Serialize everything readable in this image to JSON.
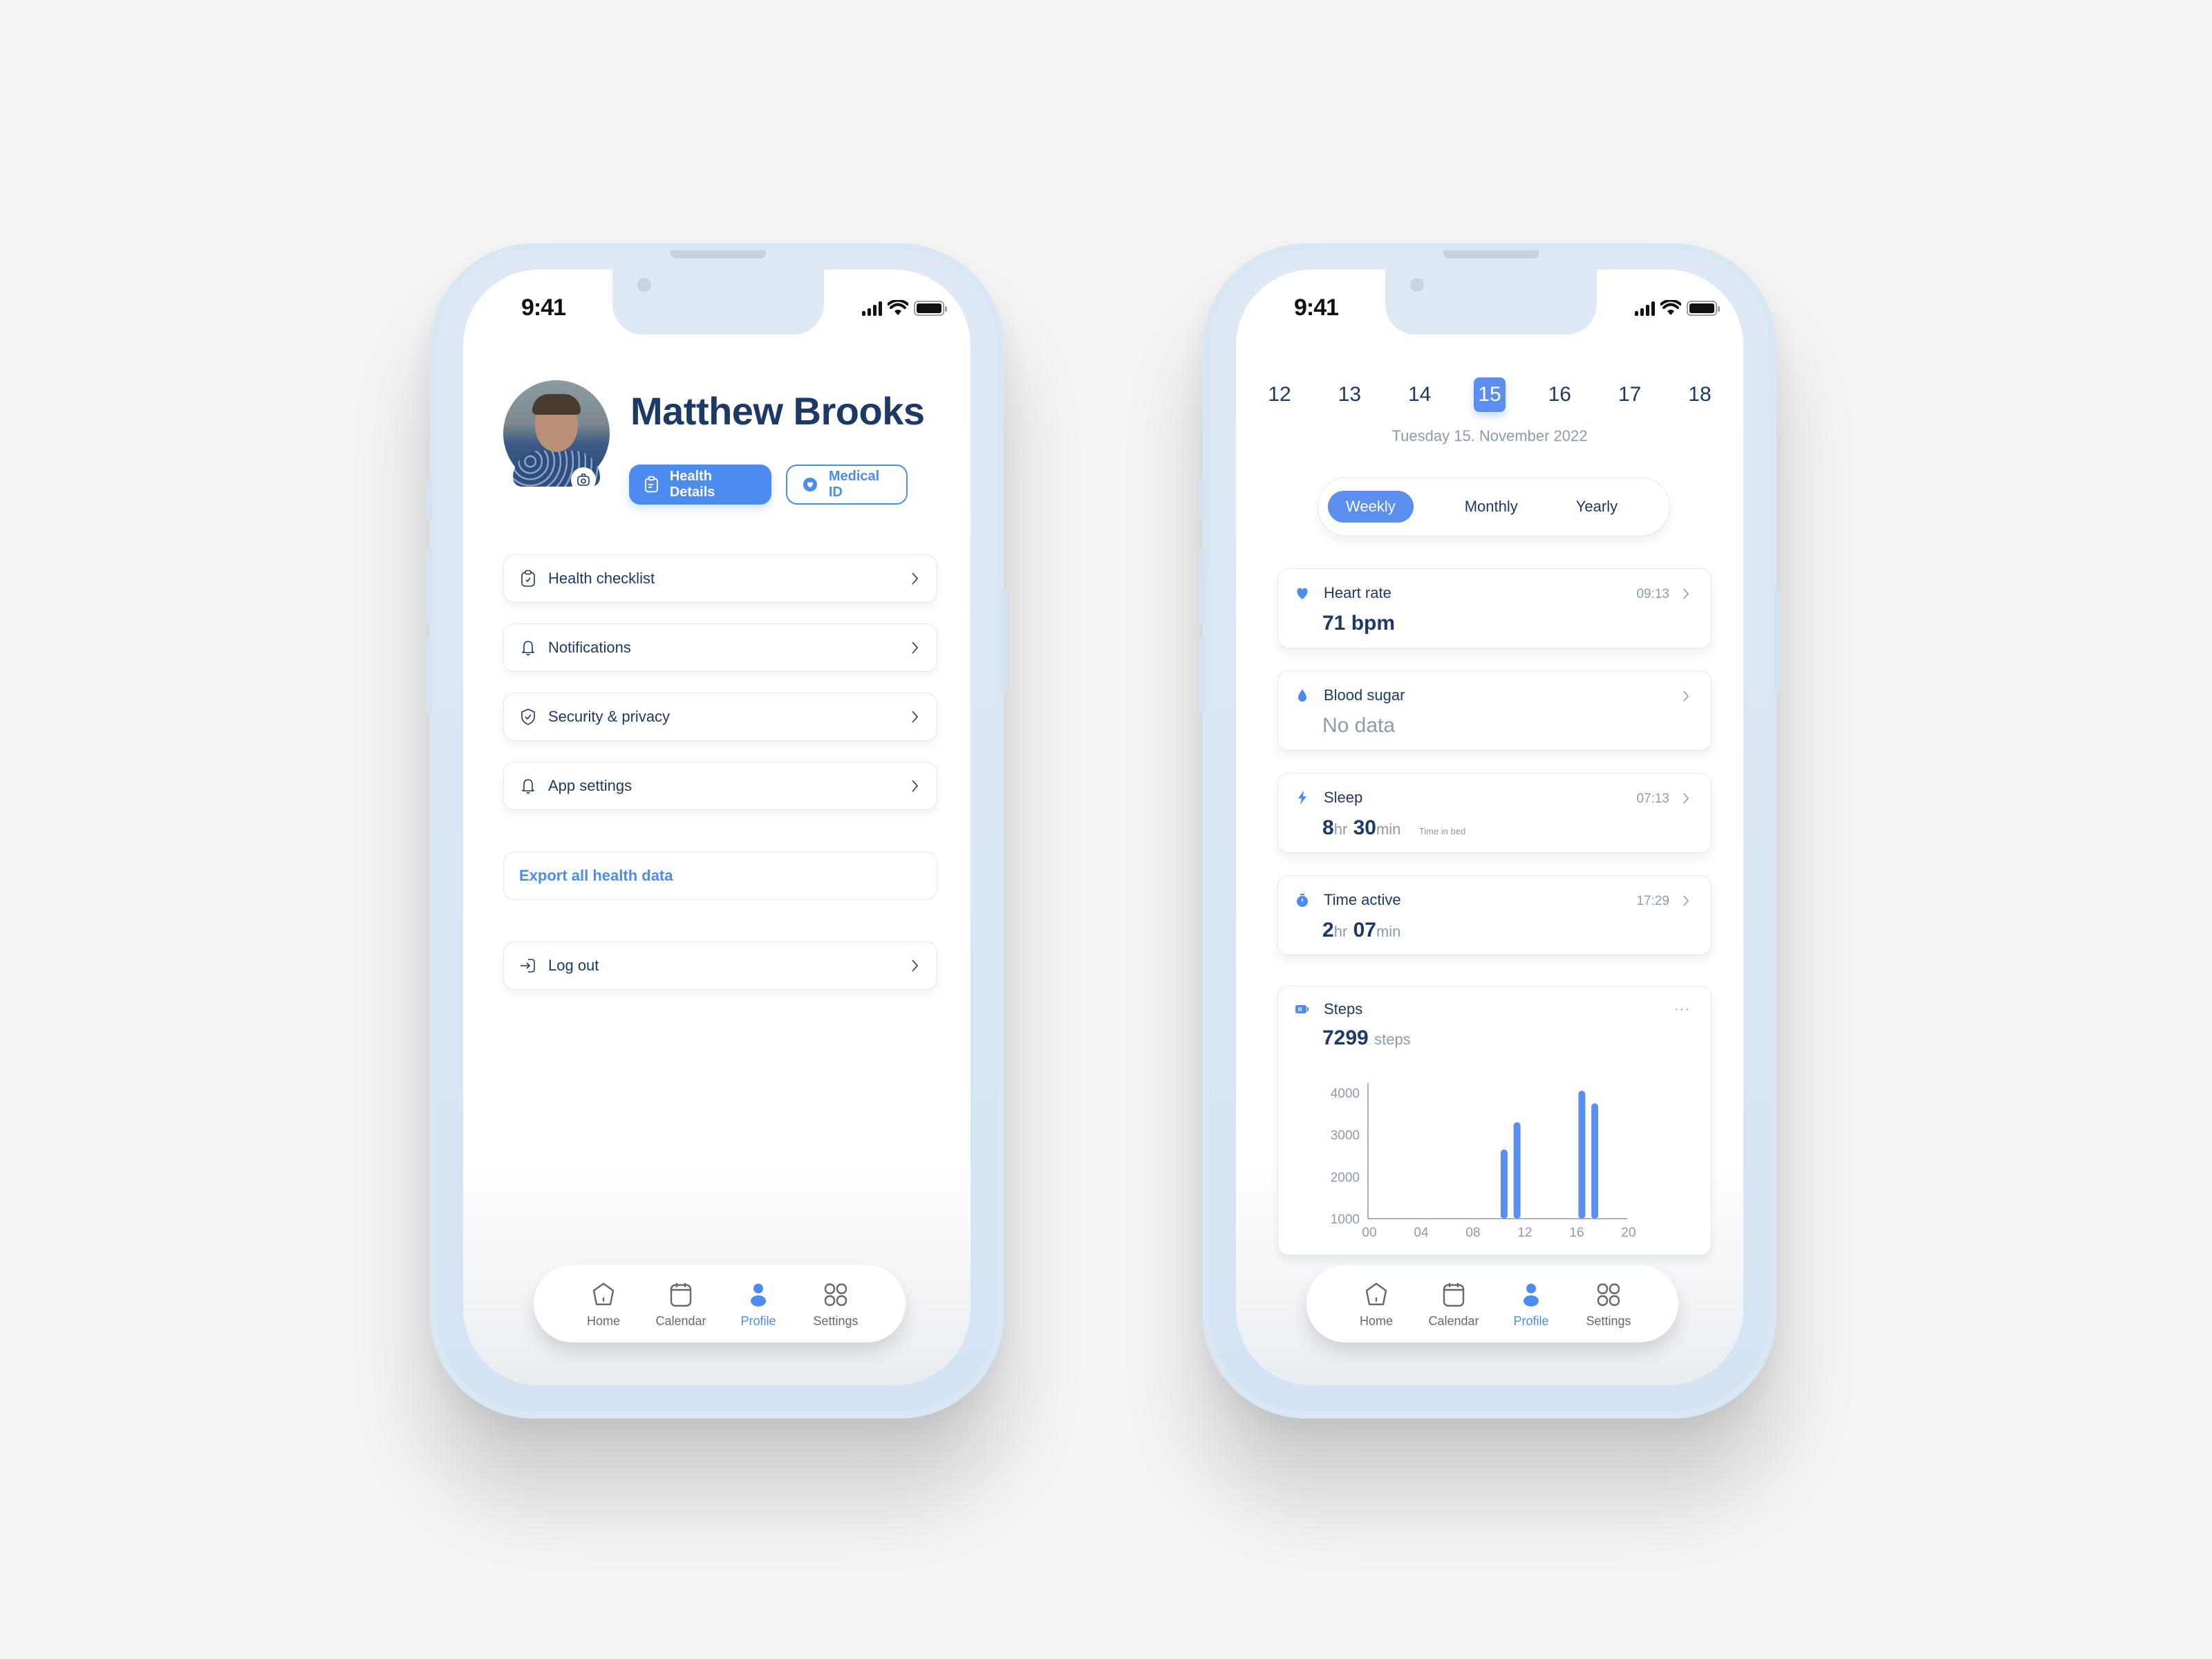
{
  "status_bar": {
    "time": "9:41"
  },
  "profile_screen": {
    "user_name": "Matthew Brooks",
    "buttons": {
      "health_details": "Health Details",
      "medical_id": "Medical ID"
    },
    "menu": [
      {
        "label": "Health checklist",
        "icon": "clipboard-check-icon"
      },
      {
        "label": "Notifications",
        "icon": "bell-icon"
      },
      {
        "label": "Security & privacy",
        "icon": "shield-check-icon"
      },
      {
        "label": "App settings",
        "icon": "bell-icon"
      }
    ],
    "export_label": "Export all health data",
    "logout_label": "Log out"
  },
  "tabbar": {
    "items": [
      {
        "label": "Home",
        "icon": "home-icon",
        "active": false
      },
      {
        "label": "Calendar",
        "icon": "calendar-icon",
        "active": false
      },
      {
        "label": "Profile",
        "icon": "person-icon",
        "active": true
      },
      {
        "label": "Settings",
        "icon": "grid-icon",
        "active": false
      }
    ]
  },
  "dashboard_screen": {
    "days": [
      "12",
      "13",
      "14",
      "15",
      "16",
      "17",
      "18"
    ],
    "selected_day": "15",
    "date_label": "Tuesday 15. November 2022",
    "segments": [
      "Weekly",
      "Monthly",
      "Yearly"
    ],
    "selected_segment": "Weekly",
    "metrics": {
      "heart_rate": {
        "title": "Heart rate",
        "time": "09:13",
        "value": "71 bpm"
      },
      "blood_sugar": {
        "title": "Blood sugar",
        "value": "No data"
      },
      "sleep": {
        "title": "Sleep",
        "time": "07:13",
        "hours": "8",
        "hours_unit": "hr",
        "minutes": "30",
        "minutes_unit": "min",
        "note": "Time in bed"
      },
      "time_active": {
        "title": "Time active",
        "time": "17:29",
        "hours": "2",
        "hours_unit": "hr",
        "minutes": "07",
        "minutes_unit": "min"
      },
      "steps": {
        "title": "Steps",
        "value": "7299",
        "unit": "steps",
        "more": "···"
      }
    }
  },
  "colors": {
    "accent": "#4c8bf0",
    "text_primary": "#1d3a66",
    "text_muted": "#8b9bb0"
  },
  "chart_data": {
    "type": "bar",
    "title": "Steps",
    "xlabel": "",
    "ylabel": "",
    "x_ticks": [
      "00",
      "04",
      "08",
      "12",
      "16",
      "20"
    ],
    "y_ticks": [
      1000,
      2000,
      3000,
      4000
    ],
    "xlim": [
      0,
      20
    ],
    "ylim": [
      1000,
      4000
    ],
    "grid": false,
    "bars": [
      {
        "hour": 10.5,
        "value": 2650
      },
      {
        "hour": 11.5,
        "value": 3300
      },
      {
        "hour": 16.5,
        "value": 4050
      },
      {
        "hour": 17.5,
        "value": 3750
      }
    ]
  }
}
